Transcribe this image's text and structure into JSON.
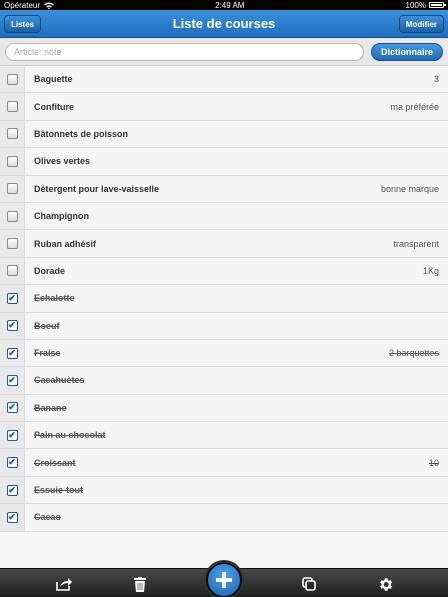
{
  "status_bar": {
    "carrier": "Opérateur",
    "time": "2:49 AM",
    "battery": "100%"
  },
  "nav": {
    "title": "Liste de courses",
    "left_button": "Listes",
    "right_button": "Modifier"
  },
  "search": {
    "placeholder": "Article: note",
    "dictionary_button": "Dictionnaire"
  },
  "items": [
    {
      "name": "Baguette",
      "note": "3",
      "checked": false
    },
    {
      "name": "Confiture",
      "note": "ma préférée",
      "checked": false
    },
    {
      "name": "Bâtonnets de poisson",
      "note": "",
      "checked": false
    },
    {
      "name": "Olives vertes",
      "note": "",
      "checked": false
    },
    {
      "name": "Détergent pour lave-vaisselle",
      "note": "bonne marque",
      "checked": false
    },
    {
      "name": "Champignon",
      "note": "",
      "checked": false
    },
    {
      "name": "Ruban adhésif",
      "note": "transparent",
      "checked": false
    },
    {
      "name": "Dorade",
      "note": "1Kg",
      "checked": false
    },
    {
      "name": "Echalotte",
      "note": "",
      "checked": true
    },
    {
      "name": "Boeuf",
      "note": "",
      "checked": true
    },
    {
      "name": "Fraise",
      "note": "2 barquettes",
      "checked": true
    },
    {
      "name": "Cacahuètes",
      "note": "",
      "checked": true
    },
    {
      "name": "Banane",
      "note": "",
      "checked": true
    },
    {
      "name": "Pain au chocolat",
      "note": "",
      "checked": true
    },
    {
      "name": "Croissant",
      "note": "10",
      "checked": true
    },
    {
      "name": "Essuie-tout",
      "note": "",
      "checked": true
    },
    {
      "name": "Cacao",
      "note": "",
      "checked": true
    }
  ],
  "toolbar": {
    "icons": [
      "share-icon",
      "trash-icon",
      "add-icon",
      "copy-icon",
      "gear-icon"
    ]
  },
  "colors": {
    "accent": "#1f6fc0",
    "check": "#1a5aa0"
  }
}
